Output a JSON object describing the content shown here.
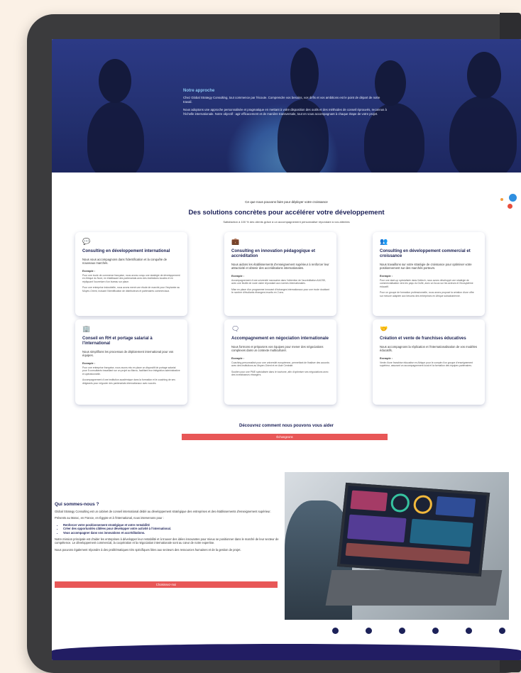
{
  "hero": {
    "title": "Notre approche",
    "p1": "Chez Global Strategy Consulting, tout commence par l'écoute. Comprendre vos besoins, vos défis et vos ambitions est le point de départ de notre travail.",
    "p2": "Nous adoptons une approche personnalisée et pragmatique en mettant à votre disposition des outils et des méthodes de conseil éprouvés, reconnus à l'échelle internationale. Notre objectif : agir efficacement et de manière transversale, tout en vous accompagnant à chaque étape de votre projet."
  },
  "services": {
    "kicker": "Ce que nous pouvons faire pour déployer votre croissance",
    "title": "Des solutions concrètes pour accélérer votre développement",
    "subtitle": "Satisfaction à 100 % des clients grâce à un accompagnement personnalisé répondant à vos attentes",
    "example_label": "Exemple :",
    "cards": [
      {
        "icon": "💬",
        "title": "Consulting en développement international",
        "desc": "Nous vous accompagnons dans l'identification et la conquête de nouveaux marchés.",
        "ex1": "Pour une école de commerce française, nous avons conçu une stratégie de développement en Afrique du Nord, en établissant des partenariats avec des institutions locales et en répliquant l'ouverture d'un bureau sur place.",
        "ex2": "Pour une entreprise industrielle, nous avons mené une étude de marché pour l'implanter au Moyen-Orient, incluant l'identification de distributeurs et partenaires commerciaux."
      },
      {
        "icon": "💼",
        "title": "Consulting en innovation pédagogique et accréditation",
        "desc": "Nous aidons les établissements d'enseignement supérieur à renforcer leur attractivité et obtenir des accréditations internationales.",
        "ex1": "Accompagnement d'une université marocaine dans l'obtention de l'accréditation AACSB, avec une feuille de route claire répondant aux normes internationales.",
        "ex2": "Mise en place d'un programme innovant d'échanges internationaux pour une école doublant le nombre d'étudiants étrangers inscrits en 2 ans."
      },
      {
        "icon": "👥",
        "title": "Consulting en développement commercial et croissance",
        "desc": "Nous travaillons sur votre stratégie de croissance pour optimiser votre positionnement sur des marchés porteurs.",
        "ex1": "Pour une start-up spécialisée dans l'edtech, nous avons développé une stratégie de commercialisation vers les pays du Golfe, avec un focus sur les acteurs et l'écosystème éducatif.",
        "ex2": "Pour un groupe de formation professionnelle, nous avons proposé la création d'une offre sur mesure adaptée aux besoins des entreprises en Afrique subsaharienne."
      },
      {
        "icon": "🏢",
        "title": "Conseil en RH et portage salarial à l'international",
        "desc": "Nous simplifions les processus de déploiement international pour vos équipes.",
        "ex1": "Pour une entreprise française, nous avons mis en place un dispositif de portage salarial pour 5 consultants travaillant sur un projet au Maroc, facilitant leur intégration administrative et opérationnelle.",
        "ex2": "Accompagnement d'une institution académique dans la formation et le coaching de ses dirigeants pour négocier des partenariats internationaux avec succès."
      },
      {
        "icon": "🗨",
        "title": "Accompagnement en négociation internationale",
        "desc": "Nous formons et préparons vos équipes pour mener des négociations complexes dans un contexte multiculturel.",
        "ex1": "Coaching personnalisé pour une université européenne, permettant de finaliser des accords avec des institutions au Moyen-Orient et en Asie Centrale.",
        "ex2": "Soutien pour une PME spécialisée dans le tourisme, afin d'optimiser ses négociations avec des investisseurs étrangers."
      },
      {
        "icon": "🤝",
        "title": "Création et vente de franchises éducatives",
        "desc": "Nous accompagnons la réplication et l'internationalisation de vos modèles éducatifs.",
        "ex1": "Vente d'une franchise éducative en Afrique pour le compte d'un groupe d'enseignement supérieur, assurant un accompagnement local et la formation des équipes partenaires.",
        "ex2": ""
      }
    ]
  },
  "cta": {
    "title": "Découvrez comment nous pouvons vous aider",
    "button": "Échangeons"
  },
  "who": {
    "title": "Qui sommes-nous ?",
    "p1": "Global Strategy Consulting est un cabinet de conseil international dédié au développement stratégique des entreprises et des établissements d'enseignement supérieur.",
    "p2": "Présents au Maroc, en France, en Égypte et à l'international, nous intervenons pour :",
    "bullets": [
      "Renforcer votre positionnement stratégique et votre rentabilité",
      "Créer des opportunités ciblées pour développer votre activité à l'international.",
      "Vous accompagner dans vos innovations et accréditations."
    ],
    "p3": "Notre mission principale est d'aider les entreprises à développer leur rentabilité et à trouver des idées innovantes pour mieux se positionner dans le marché de leur secteur de compétence. Le développement commercial, la coopération et la négociation internationale sont au cœur de notre expertise.",
    "p4": "Nous pouvons également répondre à des problématiques très spécifiques liées aux secteurs des ressources humaines et de la gestion de projet.",
    "button": "Choisissez-moi"
  },
  "colors": {
    "navy": "#1c2158",
    "cta_red": "#e85757",
    "hero_blue": "#2c3a86",
    "accent_orange": "#f39c3c",
    "accent_blue": "#2f8fe0"
  }
}
